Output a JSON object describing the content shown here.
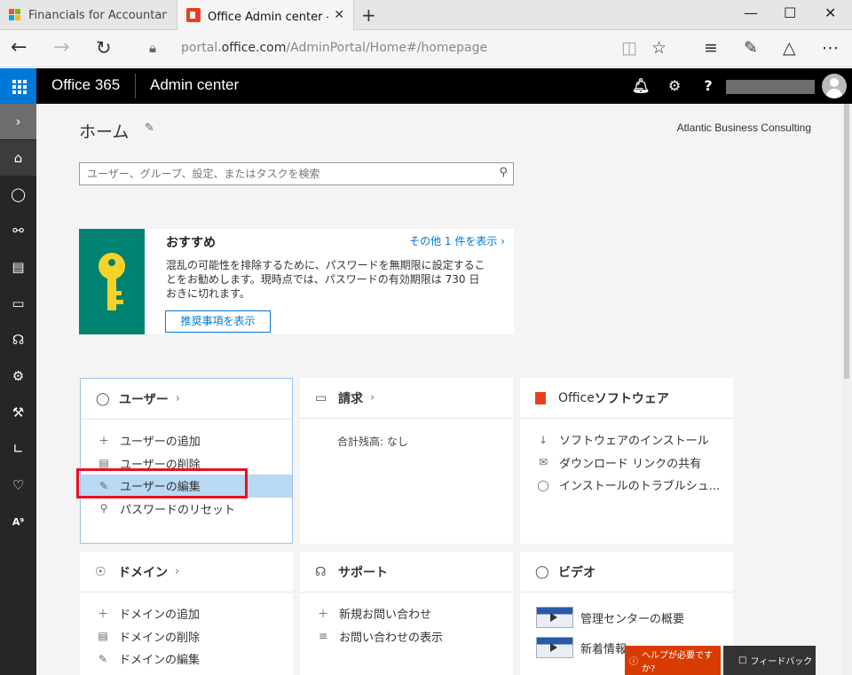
{
  "browser": {
    "tabs": [
      {
        "label": "Financials for Accountants–",
        "active": false
      },
      {
        "label": "Office Admin center - ホ",
        "active": true
      }
    ],
    "url_prefix": "portal.",
    "url_domain": "office.com",
    "url_path": "/AdminPortal/Home#/homepage",
    "tab_close_glyph": "✕",
    "new_tab_glyph": "+",
    "window_controls": [
      "—",
      "☐",
      "✕"
    ]
  },
  "header": {
    "brand": "Office 365",
    "app_name": "Admin center"
  },
  "rail": {
    "icons": [
      "chevron-right-icon",
      "home-icon",
      "user-icon",
      "groups-icon",
      "resources-icon",
      "billing-icon",
      "support-icon",
      "settings-icon",
      "setup-icon",
      "reports-icon",
      "health-icon",
      "admin-centers-icon"
    ]
  },
  "page": {
    "title": "ホーム",
    "org_name": "Atlantic Business Consulting",
    "search_placeholder": "ユーザー、グループ、設定、またはタスクを検索"
  },
  "recommendation": {
    "title": "おすすめ",
    "more_link": "その他 1 件を表示",
    "body": "混乱の可能性を排除するために、パスワードを無期限に設定することをお勧めします。現時点では、パスワードの有効期限は 730 日おきに切れます。",
    "button": "推奨事項を表示"
  },
  "cards": {
    "users": {
      "title": "ユーザー",
      "links": [
        "ユーザーの追加",
        "ユーザーの削除",
        "ユーザーの編集",
        "パスワードのリセット"
      ]
    },
    "billing": {
      "title": "請求",
      "note": "合計残高: なし"
    },
    "software": {
      "title_prefix": "Office",
      "title_suffix": " ソフトウェア",
      "links": [
        "ソフトウェアのインストール",
        "ダウンロード リンクの共有",
        "インストールのトラブルシュ..."
      ]
    },
    "domains": {
      "title": "ドメイン",
      "links": [
        "ドメインの追加",
        "ドメインの削除",
        "ドメインの編集"
      ]
    },
    "support": {
      "title": "サポート",
      "links": [
        "新規お問い合わせ",
        "お問い合わせの表示"
      ]
    },
    "video": {
      "title": "ビデオ",
      "links": [
        "管理センターの概要",
        "新着情報"
      ]
    }
  },
  "footer": {
    "help": "ヘルプが必要ですか?",
    "feedback": "フィードバック"
  },
  "colors": {
    "accent": "#0078d7",
    "highlight_row": "#b9d8f2",
    "annotation_box": "#e81123",
    "reco_art": "#008272",
    "key_yellow": "#f8d22a",
    "help_button": "#d83b01"
  }
}
